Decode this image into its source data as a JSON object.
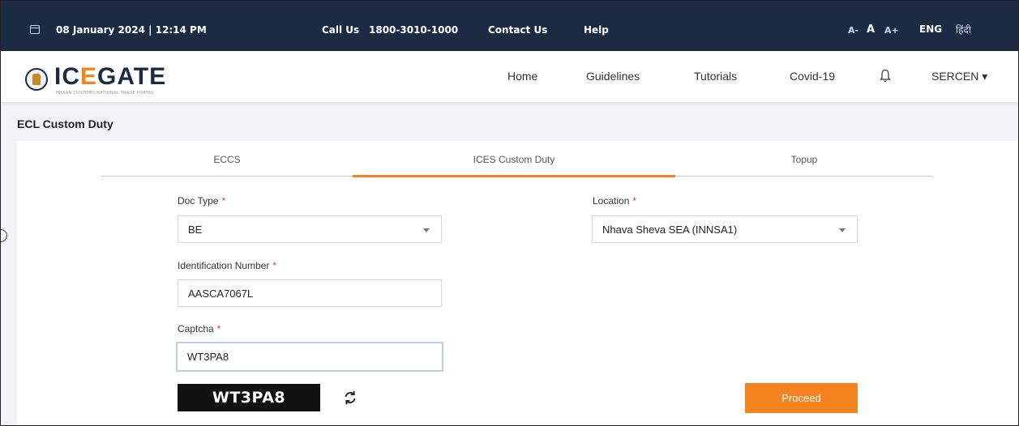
{
  "topbar": {
    "datetime": "08 January 2024 | 12:14 PM",
    "call_label": "Call Us",
    "call_number": "1800-3010-1000",
    "contact": "Contact Us",
    "help": "Help",
    "font_small": "A-",
    "font_normal": "A",
    "font_large": "A+",
    "lang_eng": "ENG",
    "lang_hindi": "हिंदी"
  },
  "header": {
    "logo_pre": "IC",
    "logo_o": "E",
    "logo_post": "GATE",
    "logo_tag": "INDIAN CUSTOMS NATIONAL TRADE PORTAL",
    "nav": [
      "Home",
      "Guidelines",
      "Tutorials",
      "Covid-19"
    ],
    "user": "SERCEN ▾"
  },
  "page": {
    "title": "ECL Custom Duty"
  },
  "tabs": [
    {
      "label": "ECCS",
      "active": false
    },
    {
      "label": "ICES Custom Duty",
      "active": true
    },
    {
      "label": "Topup",
      "active": false
    }
  ],
  "form": {
    "doc_type_label": "Doc Type",
    "doc_type_value": "BE",
    "location_label": "Location",
    "location_value": "Nhava Sheva SEA (INNSA1)",
    "id_label": "Identification Number",
    "id_value": "AASCA7067L",
    "captcha_label": "Captcha",
    "captcha_value": "WT3PA8",
    "captcha_image_text": "WT3PA8",
    "required_mark": "*",
    "proceed": "Proceed"
  },
  "colors": {
    "nav_bg": "#1c2a44",
    "accent": "#f4821f",
    "required": "#e53935"
  },
  "icons": [
    "calendar-icon",
    "bell-icon",
    "dropdown-caret-icon",
    "refresh-icon"
  ]
}
